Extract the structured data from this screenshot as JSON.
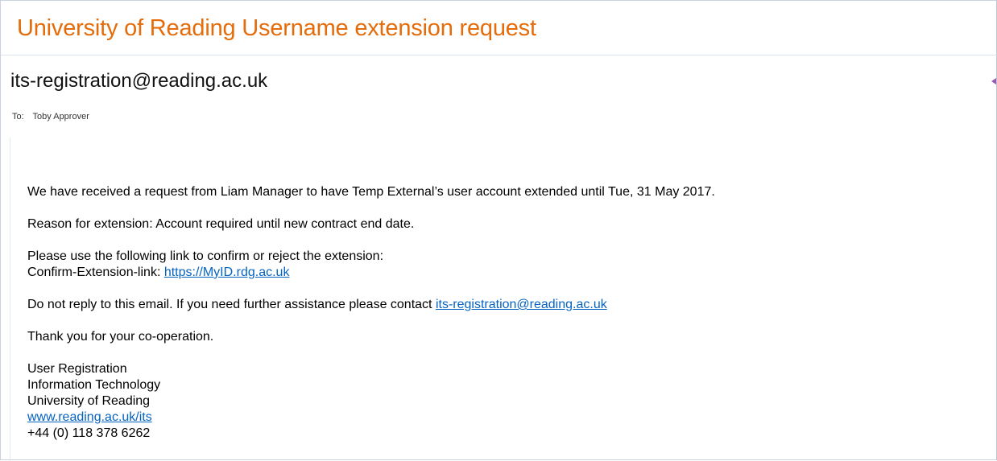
{
  "email": {
    "subject": "University of Reading Username extension request",
    "sender": "its-registration@reading.ac.uk",
    "to_label": "To:",
    "to_value": "Toby Approver"
  },
  "body": {
    "p1": "We have received a request from Liam Manager to have Temp External’s user account extended until  Tue, 31 May 2017.",
    "p2": "Reason for extension: Account required until new contract end date.",
    "p3_line1": "Please use the following link to confirm or reject the extension:",
    "p3_label": "Confirm-Extension-link: ",
    "p3_link": "https://MyID.rdg.ac.uk",
    "p4_text": "Do not reply to this email. If you need further assistance please contact ",
    "p4_link": "its-registration@reading.ac.uk",
    "p5": "Thank you for your co-operation."
  },
  "signature": {
    "line1": "User Registration",
    "line2": "Information Technology",
    "line3": "University of Reading",
    "link": "www.reading.ac.uk/its",
    "phone": "+44 (0) 118 378 6262"
  },
  "colors": {
    "subject": "#e46c0a",
    "link": "#0563c1",
    "marker": "#9b59b6"
  }
}
